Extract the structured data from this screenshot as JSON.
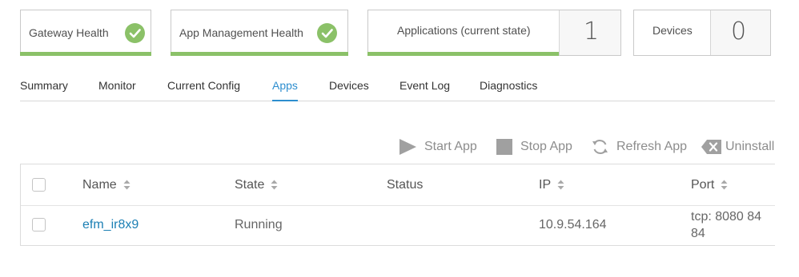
{
  "cards": {
    "gateway_health": {
      "label": "Gateway Health",
      "status": "ok"
    },
    "app_management_health": {
      "label": "App Management Health",
      "status": "ok"
    },
    "applications": {
      "label": "Applications (current state)",
      "count": "1"
    },
    "devices": {
      "label": "Devices",
      "count": "0"
    }
  },
  "tabs": [
    {
      "label": "Summary"
    },
    {
      "label": "Monitor"
    },
    {
      "label": "Current Config"
    },
    {
      "label": "Apps",
      "active": true
    },
    {
      "label": "Devices"
    },
    {
      "label": "Event Log"
    },
    {
      "label": "Diagnostics"
    }
  ],
  "toolbar": {
    "start": "Start App",
    "stop": "Stop App",
    "refresh": "Refresh App",
    "uninstall": "Uninstall"
  },
  "table": {
    "columns": [
      "Name",
      "State",
      "Status",
      "IP",
      "Port"
    ],
    "rows": [
      {
        "name": "efm_ir8x9",
        "state": "Running",
        "status": "",
        "ip": "10.9.54.164",
        "port_line1": "tcp: 8080 84",
        "port_line2": "84"
      }
    ]
  },
  "colors": {
    "health_ok": "#8bc168",
    "tab_active": "#2d8ecf",
    "link": "#1b7fb4"
  },
  "icons": {
    "health": "checkmark-circle-icon",
    "start": "play-icon",
    "stop": "stop-icon",
    "refresh": "refresh-icon",
    "uninstall": "backspace-x-icon",
    "sort": "sort-arrows-icon"
  }
}
